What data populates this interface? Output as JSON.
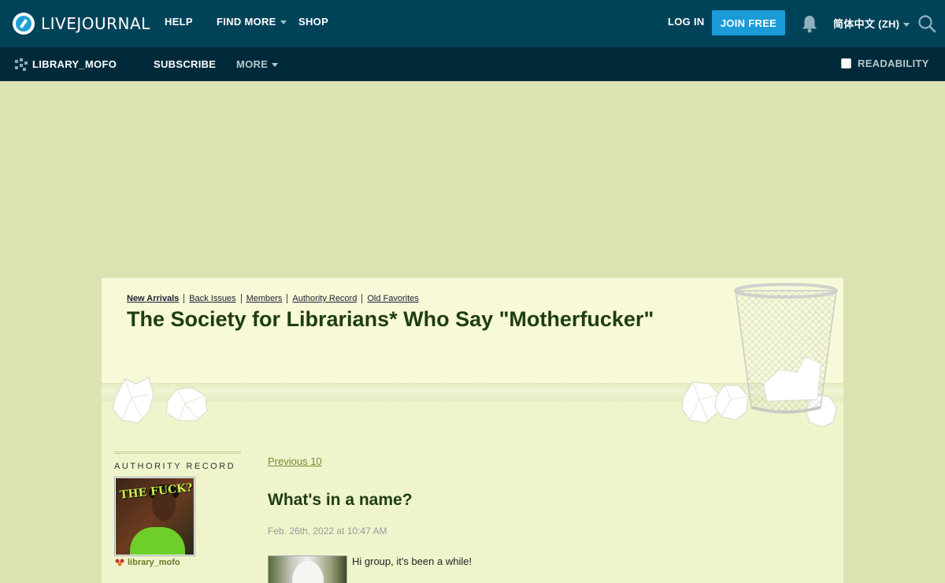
{
  "topbar": {
    "logo_text": "LIVEJOURNAL",
    "nav": [
      "HELP",
      "FIND MORE",
      "SHOP"
    ],
    "login": "LOG IN",
    "join": "JOIN FREE",
    "language": "简体中文 (ZH)",
    "icons": [
      "livejournal-logo-icon",
      "bell-icon",
      "search-icon"
    ]
  },
  "subbar": {
    "username": "LIBRARY_MOFO",
    "subscribe": "SUBSCRIBE",
    "more": "MORE",
    "readability": "READABILITY"
  },
  "journal": {
    "nav": [
      {
        "label": "New Arrivals",
        "current": true
      },
      {
        "label": "Back Issues",
        "current": false
      },
      {
        "label": "Members",
        "current": false
      },
      {
        "label": "Authority Record",
        "current": false
      },
      {
        "label": "Old Favorites",
        "current": false
      }
    ],
    "title": "The Society for Librarians* Who Say \"Motherfucker\""
  },
  "sidebar": {
    "heading": "AUTHORITY RECORD",
    "userpic_text": "THE FUCK?",
    "username": "library_mofo"
  },
  "entry": {
    "prev_link": "Previous 10",
    "title": "What's in a name?",
    "date": "Feb. 26th, 2022 at 10:47 AM",
    "body_start": "Hi group, it's been a while!"
  },
  "colors": {
    "topbar": "#004359",
    "subbar": "#002a3a",
    "join_button": "#1a9bd7",
    "page_bg": "#dce3b3",
    "journal_bg": "#eff4cc",
    "title_text": "#1e3d12"
  }
}
